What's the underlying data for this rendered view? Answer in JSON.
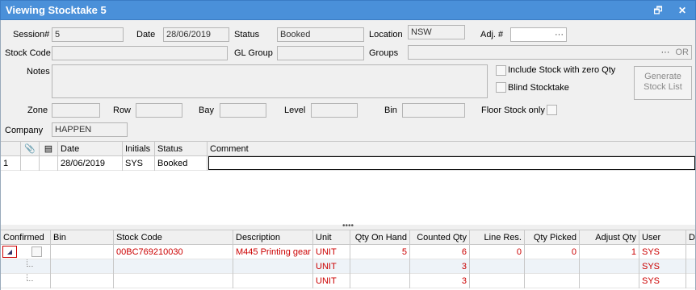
{
  "window": {
    "title": "Viewing Stocktake 5"
  },
  "header": {
    "session_label": "Session#",
    "session_value": "5",
    "date_label": "Date",
    "date_value": "28/06/2019",
    "status_label": "Status",
    "status_value": "Booked",
    "location_label": "Location",
    "location_value": "NSW",
    "adj_label": "Adj. #",
    "adj_ellipsis": "···",
    "stock_code_label": "Stock Code",
    "gl_group_label": "GL Group",
    "groups_label": "Groups",
    "groups_ellipsis": "···",
    "groups_or": "OR",
    "notes_label": "Notes",
    "include_zero_label": "Include Stock with zero Qty",
    "blind_label": "Blind Stocktake",
    "generate_label": "Generate Stock List",
    "zone_label": "Zone",
    "row_label": "Row",
    "bay_label": "Bay",
    "level_label": "Level",
    "bin_label": "Bin",
    "floor_label": "Floor Stock only",
    "company_label": "Company",
    "company_value": "HAPPEN"
  },
  "history_grid": {
    "columns": [
      "Date",
      "Initials",
      "Status",
      "Comment"
    ],
    "rows": [
      {
        "num": "1",
        "date": "28/06/2019",
        "initials": "SYS",
        "status": "Booked",
        "comment": ""
      }
    ]
  },
  "splitter_glyph": "••••",
  "lines_grid": {
    "columns": [
      "Confirmed",
      "Bin",
      "Stock Code",
      "Description",
      "Unit",
      "Qty On Hand",
      "Counted Qty",
      "Line Res.",
      "Qty Picked",
      "Adjust Qty",
      "User",
      "D"
    ],
    "rows": [
      {
        "stock_code": "00BC769210030",
        "description": "M445 Printing gear",
        "unit": "UNIT",
        "on_hand": "5",
        "counted": "6",
        "line_res": "0",
        "picked": "0",
        "adjust": "1",
        "user": "SYS"
      },
      {
        "stock_code": "",
        "description": "",
        "unit": "UNIT",
        "on_hand": "",
        "counted": "3",
        "line_res": "",
        "picked": "",
        "adjust": "",
        "user": "SYS"
      },
      {
        "stock_code": "",
        "description": "",
        "unit": "UNIT",
        "on_hand": "",
        "counted": "3",
        "line_res": "",
        "picked": "",
        "adjust": "",
        "user": "SYS"
      }
    ]
  },
  "colors": {
    "titlebar": "#4a90d9",
    "row_text": "#cc0000"
  }
}
